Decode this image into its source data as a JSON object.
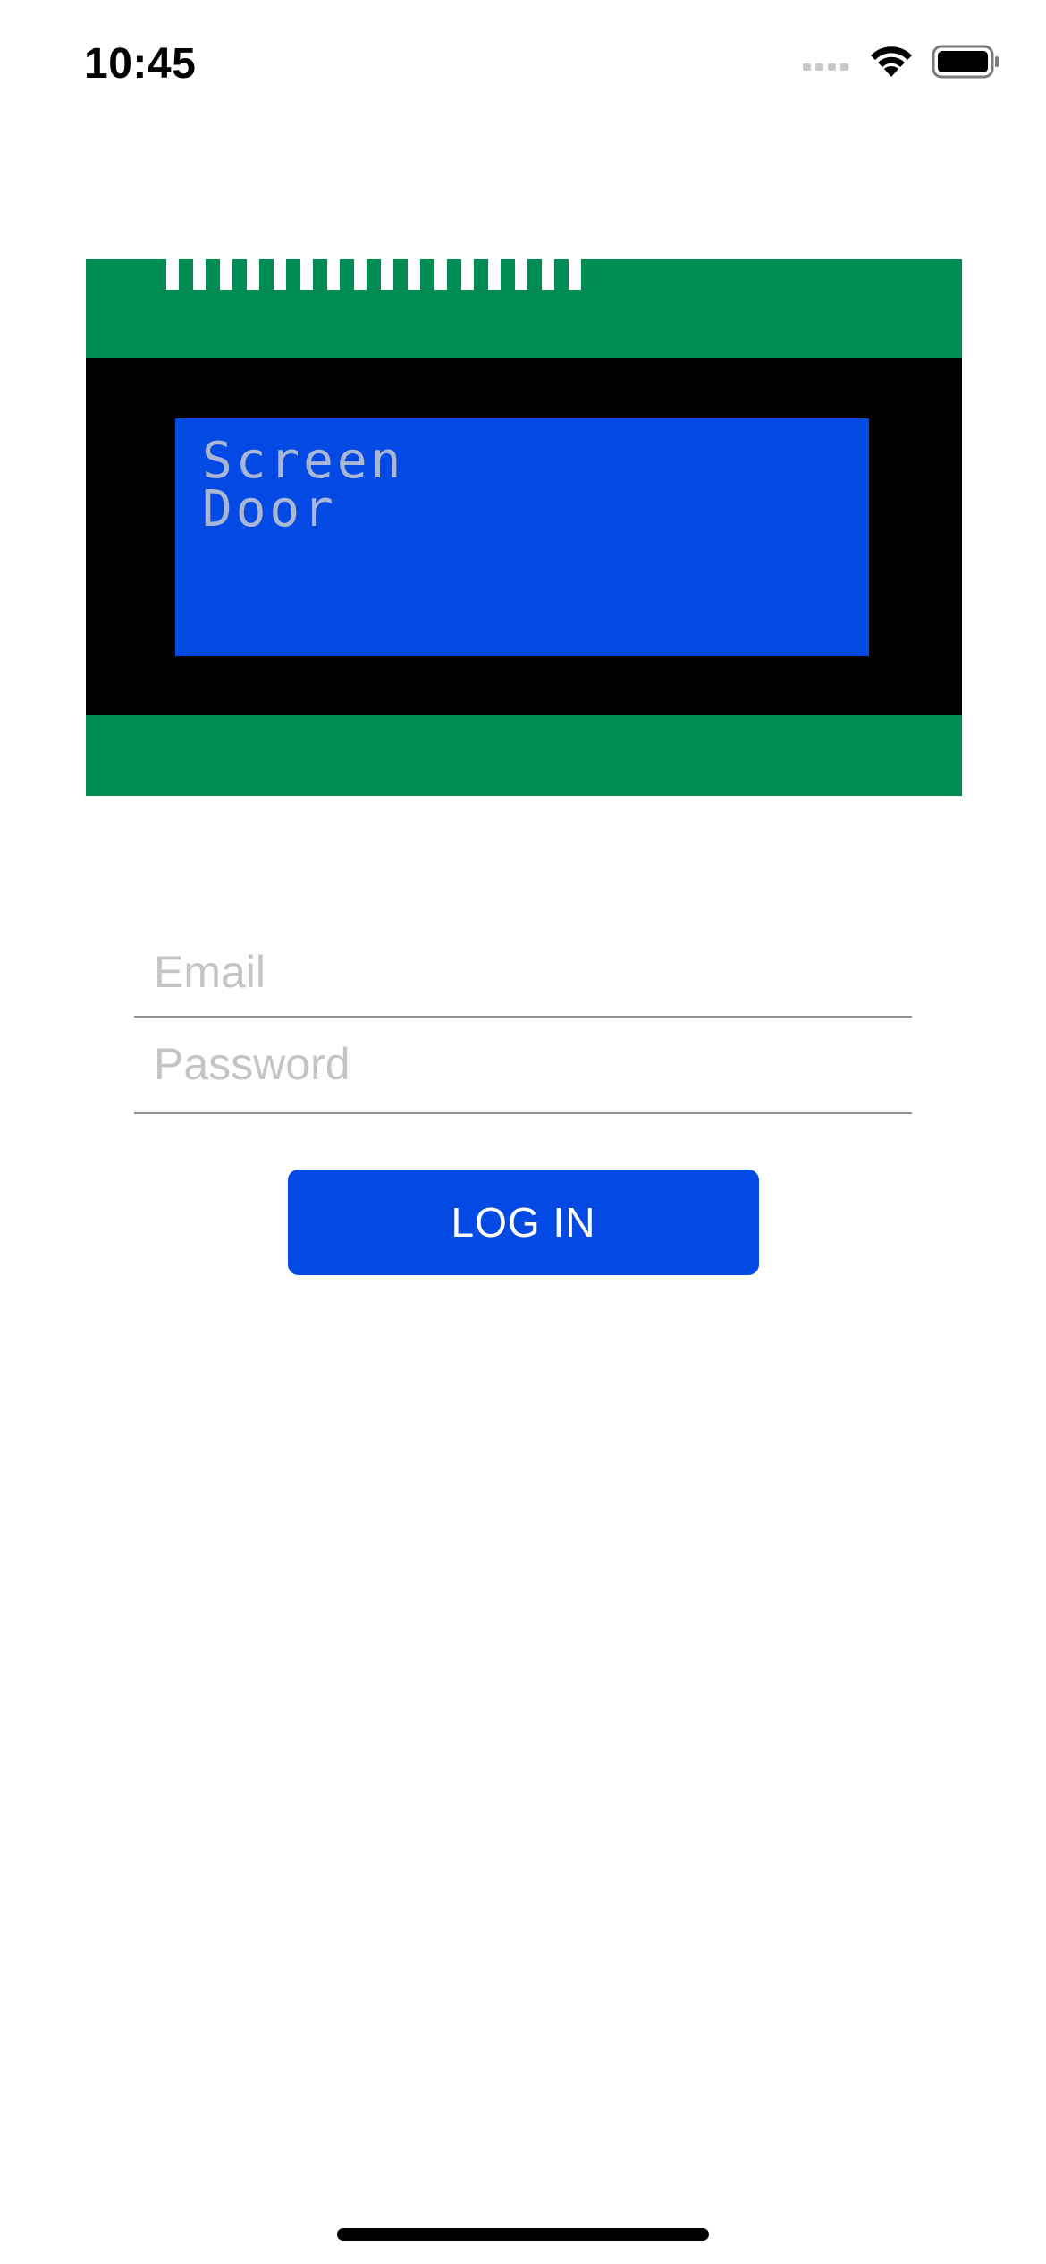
{
  "status_bar": {
    "time": "10:45",
    "icons": [
      "cellular-signal-icon",
      "wifi-icon",
      "battery-icon"
    ]
  },
  "logo": {
    "lcd_lines": [
      "Screen",
      "Door"
    ],
    "colors": {
      "pcb": "#018c54",
      "bezel": "#000000",
      "screen": "#024ae3",
      "text": "#a9b6d6"
    }
  },
  "form": {
    "email": {
      "value": "",
      "placeholder": "Email"
    },
    "password": {
      "value": "",
      "placeholder": "Password"
    },
    "login_label": "LOG IN"
  },
  "theme": {
    "accent": "#024ae3",
    "placeholder": "#c4c4c6",
    "divider": "#8e8e8e"
  }
}
